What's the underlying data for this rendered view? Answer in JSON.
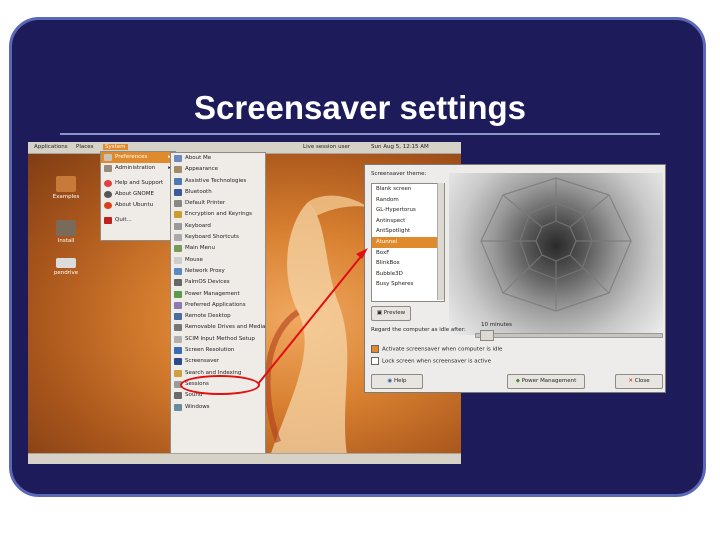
{
  "slide": {
    "title": "Screensaver settings"
  },
  "colors": {
    "slide_bg": "#1d1b5a",
    "frame_border": "#5b68b8",
    "title_text": "#ffffff",
    "menu_highlight": "#e08a2e",
    "annotation_red": "#e01010"
  },
  "desktop": {
    "top_panel": {
      "applications": "Applications",
      "places": "Places",
      "system": "System",
      "user": "Live session user",
      "datetime": "Sun Aug 5, 12:15 AM"
    },
    "icons": [
      {
        "label": "Examples",
        "icon": "folder-icon"
      },
      {
        "label": "Install",
        "icon": "install-icon"
      },
      {
        "label": "pendrive",
        "icon": "drive-icon"
      }
    ]
  },
  "system_menu": {
    "items": [
      {
        "label": "Preferences",
        "icon": "preferences-icon",
        "submenu": true
      },
      {
        "label": "Administration",
        "icon": "admin-icon",
        "submenu": true
      },
      {
        "label": "Help and Support",
        "icon": "help-icon"
      },
      {
        "label": "About GNOME",
        "icon": "gnome-icon"
      },
      {
        "label": "About Ubuntu",
        "icon": "ubuntu-icon"
      },
      {
        "label": "Quit...",
        "icon": "quit-icon"
      }
    ]
  },
  "preferences_menu": {
    "items": [
      {
        "label": "About Me"
      },
      {
        "label": "Appearance"
      },
      {
        "label": "Assistive Technologies"
      },
      {
        "label": "Bluetooth"
      },
      {
        "label": "Default Printer"
      },
      {
        "label": "Encryption and Keyrings"
      },
      {
        "label": "Keyboard"
      },
      {
        "label": "Keyboard Shortcuts"
      },
      {
        "label": "Main Menu"
      },
      {
        "label": "Mouse"
      },
      {
        "label": "Network Proxy"
      },
      {
        "label": "PalmOS Devices"
      },
      {
        "label": "Power Management"
      },
      {
        "label": "Preferred Applications"
      },
      {
        "label": "Remote Desktop"
      },
      {
        "label": "Removable Drives and Media"
      },
      {
        "label": "SCIM Input Method Setup"
      },
      {
        "label": "Screen Resolution"
      },
      {
        "label": "Screensaver"
      },
      {
        "label": "Search and Indexing"
      },
      {
        "label": "Sessions"
      },
      {
        "label": "Sound"
      },
      {
        "label": "Windows"
      }
    ]
  },
  "screensaver_dialog": {
    "theme_label": "Screensaver theme:",
    "themes": [
      "Blank screen",
      "Random",
      "GL-Hypertorus",
      "Antinspect",
      "AntSpotlight",
      "Atunnel",
      "BoxF",
      "BlinkBox",
      "Bubble3D",
      "Busy Spheres"
    ],
    "selected_theme": "Atunnel",
    "preview_button": "Preview",
    "idle_label": "Regard the computer as idle after:",
    "idle_value": "10 minutes",
    "activate_label": "Activate screensaver when computer is idle",
    "activate_checked": true,
    "lock_label": "Lock screen when screensaver is active",
    "lock_checked": false,
    "help_button": "Help",
    "power_button": "Power Management",
    "close_button": "Close"
  }
}
